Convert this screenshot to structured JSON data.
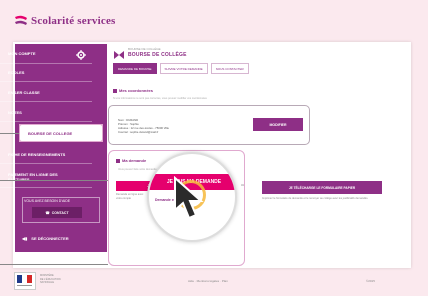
{
  "brand": {
    "name": "Scolarité services",
    "primary_color": "#8e2f86",
    "accent_color": "#e5006d"
  },
  "sidebar": {
    "items": [
      {
        "label": "MON COMPTE"
      },
      {
        "label": "ECOLES"
      },
      {
        "label": "EN 1ER CLASSE"
      },
      {
        "label": "NOTES"
      },
      {
        "label": "BOURSE DE COLLEGE"
      },
      {
        "label": "FICHE DE RENSEIGNEMENTS"
      },
      {
        "label": "PAIEMENT EN LIGNE DES FACTURES"
      }
    ],
    "contact_title": "VOUS AVEZ BESOIN D'AIDE",
    "contact_button": "CONTACT",
    "logout": "SE DÉCONNECTER"
  },
  "main": {
    "breadcrumb": "BOURSE DE COLLÈGE",
    "title": "BOURSE DE COLLÈGE",
    "tabs": [
      {
        "label": "DEMANDE DE BOURSE",
        "active": true
      },
      {
        "label": "SUIVRE VOTRE DEMANDE",
        "active": false
      },
      {
        "label": "NOUS CONTACTER",
        "active": false
      }
    ],
    "intro": "Si vos informations ne sont pas correctes, vous pouvez modifier vos coordonnées",
    "coords_section": "Mes coordonnées",
    "coords_lines": [
      "Nom : DURAND",
      "Prénom : Sophie",
      "Adresse : 12 rue des écoles - 75000 Ville",
      "Courriel : sophie.durand@mail.fr"
    ],
    "modify_button": "MODIFIER",
    "demand_section": "Ma demande",
    "demand_intro": "Vous pouvez faire votre demande en ligne",
    "online_button": "JE FAIS MA DEMANDE EN LIGNE",
    "or_label": "ou",
    "download_button": "JE TÉLÉCHARGE LE FORMULAIRE PAPIER",
    "download_note": "Imprimez le formulaire de demande et le renvoyer au collège avec les justificatifs demandés.",
    "left_note": "Demande en ligne avec votre compte"
  },
  "magnifier": {
    "button_label": "JE FAIS MA DEMANDE",
    "sub_text": "Demande en ligne"
  },
  "footer": {
    "org_lines": [
      "MINISTÈRE",
      "DE L'ÉDUCATION",
      "NATIONALE"
    ],
    "links": "Aide · Mentions légales · Plan",
    "version": "©2015"
  }
}
